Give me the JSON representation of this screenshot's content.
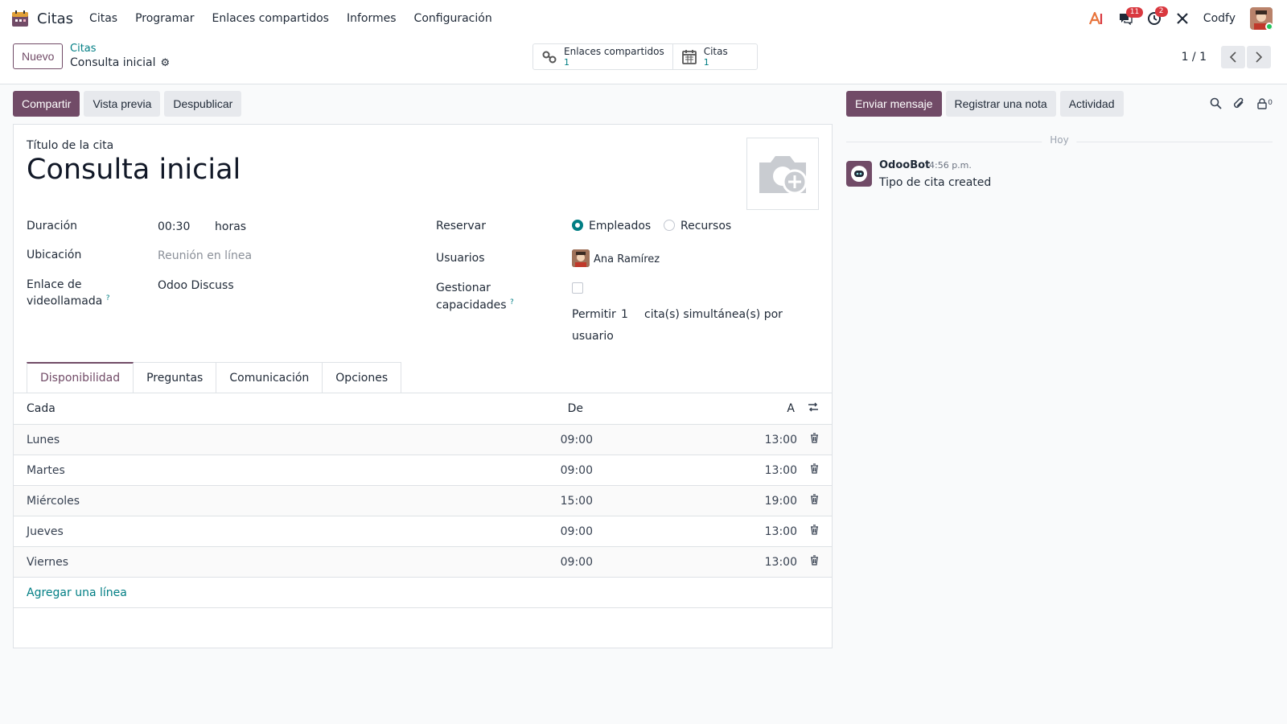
{
  "app": {
    "name": "Citas",
    "menu": [
      "Citas",
      "Programar",
      "Enlaces compartidos",
      "Informes",
      "Configuración"
    ]
  },
  "systray": {
    "messages_count": "11",
    "activities_count": "2",
    "company": "Codfy"
  },
  "control": {
    "new_label": "Nuevo",
    "breadcrumb_parent": "Citas",
    "breadcrumb_current": "Consulta inicial",
    "smart_buttons": [
      {
        "label": "Enlaces compartidos",
        "count": "1",
        "icon": "link-icon"
      },
      {
        "label": "Citas",
        "count": "1",
        "icon": "calendar-icon"
      }
    ],
    "pager": "1 / 1"
  },
  "actions": {
    "share": "Compartir",
    "preview": "Vista previa",
    "unpublish": "Despublicar"
  },
  "chatter_actions": {
    "send_message": "Enviar mensaje",
    "log_note": "Registrar una nota",
    "activity": "Actividad",
    "followers_count": "0"
  },
  "form": {
    "title_label": "Título de la cita",
    "title": "Consulta inicial",
    "duration_label": "Duración",
    "duration_value": "00:30",
    "duration_unit": "horas",
    "location_label": "Ubicación",
    "location_placeholder": "Reunión en línea",
    "videocall_label_1": "Enlace de",
    "videocall_label_2": "videollamada",
    "videocall_value": "Odoo Discuss",
    "reserve_label": "Reservar",
    "reserve_option_1": "Empleados",
    "reserve_option_2": "Recursos",
    "reserve_selected": "Empleados",
    "users_label": "Usuarios",
    "user_name": "Ana Ramírez",
    "capacity_label_1": "Gestionar",
    "capacity_label_2": "capacidades",
    "capacity_checked": false,
    "allow_prefix": "Permitir",
    "allow_value": "1",
    "allow_suffix_1": "cita(s) simultánea(s) por",
    "allow_suffix_2": "usuario",
    "help_mark": "?"
  },
  "tabs": [
    "Disponibilidad",
    "Preguntas",
    "Comunicación",
    "Opciones"
  ],
  "availability": {
    "headers": {
      "day": "Cada",
      "from": "De",
      "to": "A"
    },
    "rows": [
      {
        "day": "Lunes",
        "from": "09:00",
        "to": "13:00"
      },
      {
        "day": "Martes",
        "from": "09:00",
        "to": "13:00"
      },
      {
        "day": "Miércoles",
        "from": "15:00",
        "to": "19:00"
      },
      {
        "day": "Jueves",
        "from": "09:00",
        "to": "13:00"
      },
      {
        "day": "Viernes",
        "from": "09:00",
        "to": "13:00"
      }
    ],
    "add_line": "Agregar una línea"
  },
  "chatter": {
    "day_separator": "Hoy",
    "messages": [
      {
        "author": "OdooBot",
        "time": "4:56 p.m.",
        "body": "Tipo de cita created"
      }
    ]
  },
  "colors": {
    "primary": "#714b67",
    "link": "#017e84",
    "badge": "#d9383f"
  }
}
